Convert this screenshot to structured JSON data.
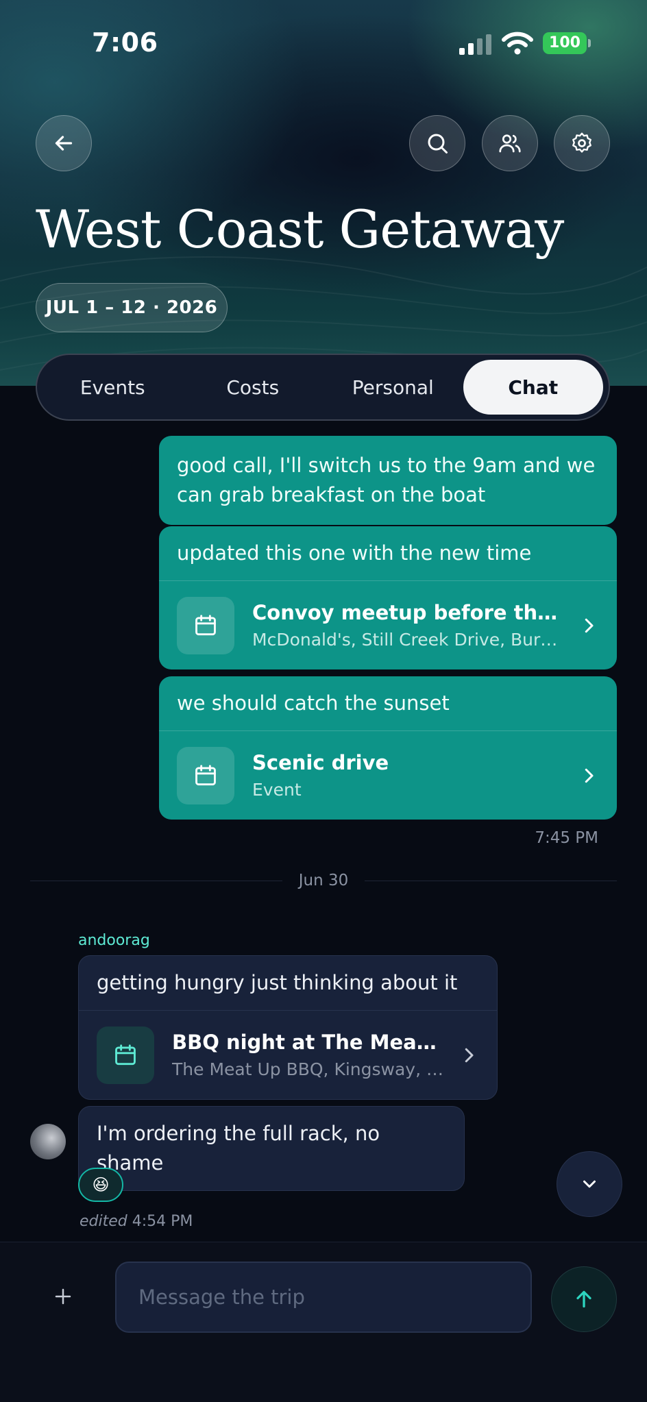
{
  "status": {
    "time": "7:06",
    "battery": "100"
  },
  "header": {
    "title": "West Coast Getaway",
    "dates": "JUL 1 – 12 · 2026",
    "icons": [
      "arrow-left-icon",
      "search-icon",
      "users-icon",
      "settings-icon"
    ]
  },
  "tabs": [
    {
      "label": "Events"
    },
    {
      "label": "Costs"
    },
    {
      "label": "Personal"
    },
    {
      "label": "Chat",
      "active": true
    }
  ],
  "messages": {
    "m1": {
      "text": "good call, I'll switch us to the 9am and we can grab breakfast on the boat"
    },
    "m2": {
      "text": "updated this one with the new time",
      "card": {
        "title": "Convoy meetup before the …",
        "subtitle": "McDonald's, Still Creek Drive, Bur…"
      }
    },
    "m3": {
      "text": "we should catch the sunset",
      "card": {
        "title": "Scenic drive",
        "subtitle": "Event"
      }
    },
    "outgoing_time": "7:45 PM",
    "date_separator": "Jun 30",
    "sender": "andoorag",
    "m4": {
      "text": "getting hungry just thinking about it",
      "card": {
        "title": "BBQ night at The Meat …",
        "subtitle": "The Meat Up BBQ, Kingsway, …"
      }
    },
    "m5": {
      "text": "I'm ordering the full rack, no shame"
    },
    "reaction": "😆",
    "edited_label": "edited",
    "edited_time": "4:54 PM"
  },
  "composer": {
    "placeholder": "Message the trip"
  },
  "colors": {
    "accent": "#0d9488",
    "background": "#070b14",
    "incoming_bubble": "#18223a",
    "battery": "#34c759"
  }
}
